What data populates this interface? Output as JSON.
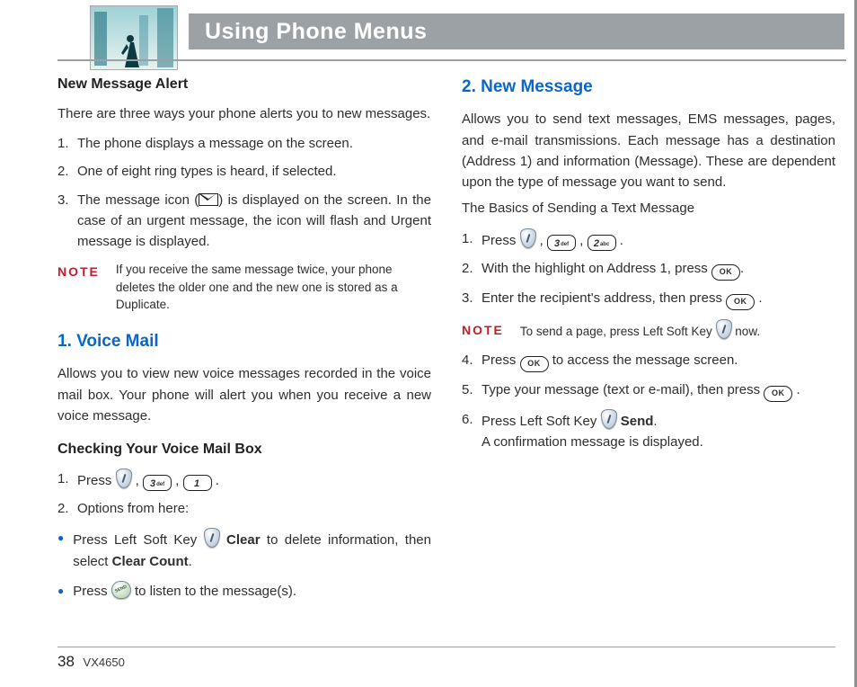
{
  "header": {
    "title": "Using Phone Menus"
  },
  "left": {
    "alert_heading": "New Message Alert",
    "alert_intro": "There are three ways your phone alerts you to new messages.",
    "alert_items": [
      "The phone displays a message on the screen.",
      "One of eight ring types is heard, if selected.",
      {
        "pre": "The message icon (",
        "post": ") is displayed on the screen. In the case of an urgent message, the icon will flash and Urgent message is displayed."
      }
    ],
    "note_label": "NOTE",
    "note_text": "If you receive the same message twice, your phone deletes the older one and the new one is stored as a Duplicate.",
    "vm_title": "1. Voice Mail",
    "vm_intro": "Allows you to view new voice messages recorded in the voice mail box. Your phone will alert you when you receive a new voice message.",
    "vm_check_heading": "Checking Your Voice Mail Box",
    "vm_step1_press": "Press ",
    "vm_step1_dot": ".",
    "vm_step2": "Options from here:",
    "vm_bullet1_pre": "Press Left Soft Key ",
    "vm_bullet1_clear": "Clear",
    "vm_bullet1_mid": " to delete information,  then select ",
    "vm_bullet1_cc": "Clear Count",
    "vm_bullet1_end": ".",
    "vm_bullet2_pre": "Press ",
    "vm_bullet2_post": " to listen to the message(s)."
  },
  "right": {
    "nm_title": "2. New Message",
    "nm_intro": "Allows you to send text messages, EMS messages, pages, and e-mail transmissions. Each message has a destination (Address 1) and information (Message). These are dependent upon the type of message you want to send.",
    "nm_basics": "The Basics of Sending a Text Message",
    "step1_press": "Press ",
    "step1_dot": ".",
    "step2_pre": "With the highlight on Address 1, press ",
    "step2_dot": ".",
    "step3_pre": "Enter the recipient's address, then press ",
    "step3_dot": ".",
    "note_label": "NOTE",
    "note_pre": "To send a page, press Left Soft Key ",
    "note_post": " now.",
    "step4_pre": "Press ",
    "step4_post": " to access the message screen.",
    "step5_pre": "Type your message (text or e-mail), then press ",
    "step5_dot": ".",
    "step6_pre": "Press Left Soft Key ",
    "step6_send": "Send",
    "step6_dot": ".",
    "step6_line2": "A confirmation message is displayed."
  },
  "keys": {
    "k3_big": "3",
    "k3_small": "def",
    "k2_big": "2",
    "k2_small": "abc",
    "k1_big": "1",
    "k1_small": "",
    "ok": "OK"
  },
  "footer": {
    "page": "38",
    "model": "VX4650"
  }
}
